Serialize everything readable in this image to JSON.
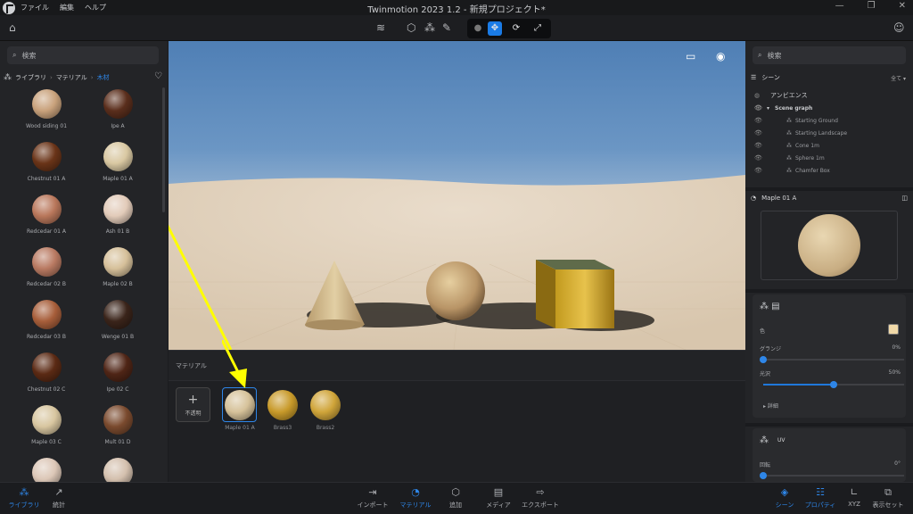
{
  "app": {
    "title": "Twinmotion 2023 1.2 - 新規プロジェクト*",
    "menu": [
      "ファイル",
      "編集",
      "ヘルプ"
    ]
  },
  "library": {
    "search_placeholder": "検索",
    "breadcrumb": [
      "ライブラリ",
      "マテリアル",
      "木材"
    ],
    "materials": [
      {
        "name": "Wood siding 01",
        "color": "#c9a27c"
      },
      {
        "name": "Ipe A",
        "color": "#5a2e1c"
      },
      {
        "name": "Chestnut 01 A",
        "color": "#6a3418"
      },
      {
        "name": "Maple 01 A",
        "color": "#d9c8a2"
      },
      {
        "name": "Redcedar 01 A",
        "color": "#b9775b"
      },
      {
        "name": "Ash 01 B",
        "color": "#e2cbb9"
      },
      {
        "name": "Redcedar 02 B",
        "color": "#b97a62"
      },
      {
        "name": "Maple 02 B",
        "color": "#d6c09a"
      },
      {
        "name": "Redcedar 03 B",
        "color": "#a75e3a"
      },
      {
        "name": "Wenge 01 B",
        "color": "#3a241a"
      },
      {
        "name": "Chestnut 02 C",
        "color": "#5b2a14"
      },
      {
        "name": "Ipe 02 C",
        "color": "#4f2516"
      },
      {
        "name": "Maple 03 C",
        "color": "#d8c6a0"
      },
      {
        "name": "Mult 01 D",
        "color": "#7a4a2e"
      },
      {
        "name": "",
        "color": "#dcc7b7"
      },
      {
        "name": "",
        "color": "#d4c0ae"
      }
    ]
  },
  "viewport": {
    "tools": [
      "layout-icon",
      "eye-icon"
    ]
  },
  "drawer": {
    "title": "マテリアル",
    "add_label": "不透明",
    "slots": [
      {
        "name": "Maple 01 A",
        "color": "#d6c29a"
      },
      {
        "name": "Brass3",
        "color": "#c89a2a"
      },
      {
        "name": "Brass2",
        "color": "#d0a53a"
      }
    ]
  },
  "bottom": {
    "left": [
      {
        "label": "ライブラリ",
        "icon": "library-icon"
      },
      {
        "label": "統計",
        "icon": "chart-icon"
      }
    ],
    "center": [
      {
        "label": "インポート",
        "icon": "import-icon"
      },
      {
        "label": "マテリアル",
        "icon": "material-icon"
      },
      {
        "label": "追加",
        "icon": "add-icon"
      },
      {
        "label": "メディア",
        "icon": "media-icon"
      },
      {
        "label": "エクスポート",
        "icon": "export-icon"
      }
    ],
    "right": [
      {
        "label": "シーン",
        "icon": "scene-icon"
      },
      {
        "label": "プロパティ",
        "icon": "properties-icon"
      },
      {
        "label": "XYZ",
        "icon": "xyz-icon"
      },
      {
        "label": "表示セット",
        "icon": "view-set-icon"
      }
    ]
  },
  "scene": {
    "search_placeholder": "検索",
    "title": "シーン",
    "filter": "全て",
    "ambience": "アンビエンス",
    "graph": "Scene graph",
    "items": [
      "Starting Ground",
      "Starting Landscape",
      "Cone 1m",
      "Sphere 1m",
      "Chamfer Box"
    ]
  },
  "properties": {
    "material_name": "Maple 01 A",
    "color_label": "色",
    "grunge_label": "グランジ",
    "grunge_value": "0%",
    "grunge_pct": 0,
    "gloss_label": "光沢",
    "gloss_value": "50%",
    "gloss_pct": 50,
    "details_label": "詳細",
    "uv_label": "UV",
    "rotation_label": "回転",
    "rotation_value": "0°",
    "swatch_color": "#f0d9a8"
  },
  "colors": {
    "accent": "#2e86e8"
  }
}
